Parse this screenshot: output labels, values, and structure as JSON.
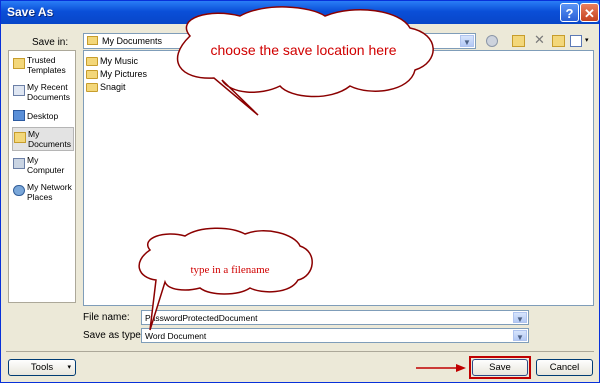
{
  "window": {
    "title": "Save As"
  },
  "titlebar": {
    "help_glyph": "?",
    "close_glyph": "✕"
  },
  "lookin": {
    "label": "Save in:",
    "value": "My Documents"
  },
  "toolbar_icons": [
    "back-icon",
    "up-folder-icon",
    "delete-icon",
    "new-folder-icon",
    "views-icon"
  ],
  "places": [
    {
      "label": "Trusted Templates",
      "icon": "folder-icon"
    },
    {
      "label": "My Recent Documents",
      "icon": "recent-docs-icon"
    },
    {
      "label": "Desktop",
      "icon": "desktop-icon"
    },
    {
      "label": "My Documents",
      "icon": "folder-icon"
    },
    {
      "label": "My Computer",
      "icon": "computer-icon"
    },
    {
      "label": "My Network Places",
      "icon": "network-icon"
    }
  ],
  "files": [
    {
      "name": "My Music"
    },
    {
      "name": "My Pictures"
    },
    {
      "name": "Snagit"
    }
  ],
  "filename": {
    "label": "File name:",
    "value": "PasswordProtectedDocument"
  },
  "savetype": {
    "label": "Save as type:",
    "value": "Word Document"
  },
  "buttons": {
    "tools": "Tools",
    "save": "Save",
    "cancel": "Cancel"
  },
  "callouts": {
    "location": "choose the save location here",
    "filename": "type in a filename"
  },
  "colors": {
    "callout_text": "#d00000",
    "highlight": "#c00000",
    "titlebar": "#0a4fd8"
  }
}
